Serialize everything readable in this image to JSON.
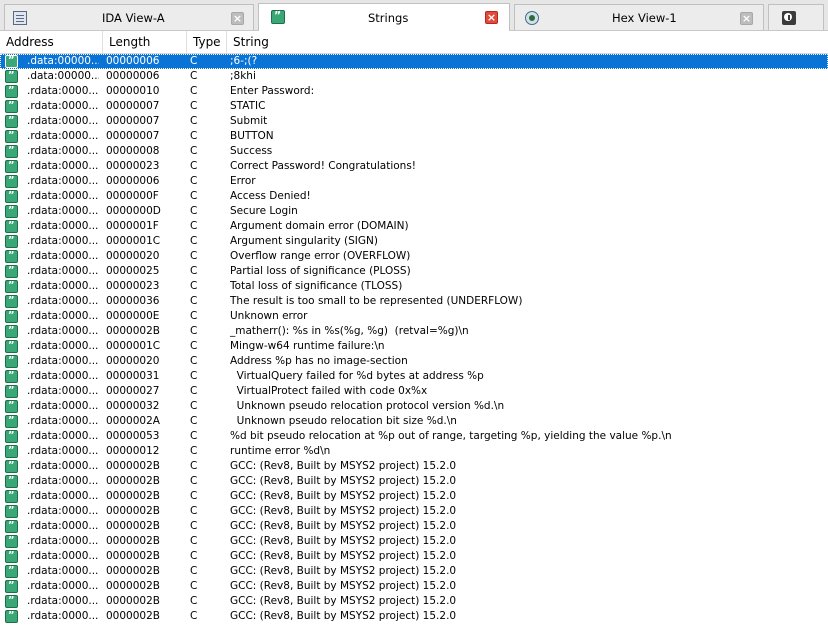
{
  "tabs": [
    {
      "label": "IDA View-A",
      "icon": "ida-view-icon",
      "active": false
    },
    {
      "label": "Strings",
      "icon": "strings-icon",
      "active": true
    },
    {
      "label": "Hex View-1",
      "icon": "hex-view-icon",
      "active": false
    },
    {
      "label": "",
      "icon": "info-icon",
      "active": false
    }
  ],
  "columns": [
    "Address",
    "Length",
    "Type",
    "String"
  ],
  "rows": [
    {
      "address": ".data:00000...",
      "length": "00000006",
      "type": "C",
      "string": ";6-;(?"
    },
    {
      "address": ".data:00000...",
      "length": "00000006",
      "type": "C",
      "string": ";8khi"
    },
    {
      "address": ".rdata:0000...",
      "length": "00000010",
      "type": "C",
      "string": "Enter Password:"
    },
    {
      "address": ".rdata:0000...",
      "length": "00000007",
      "type": "C",
      "string": "STATIC"
    },
    {
      "address": ".rdata:0000...",
      "length": "00000007",
      "type": "C",
      "string": "Submit"
    },
    {
      "address": ".rdata:0000...",
      "length": "00000007",
      "type": "C",
      "string": "BUTTON"
    },
    {
      "address": ".rdata:0000...",
      "length": "00000008",
      "type": "C",
      "string": "Success"
    },
    {
      "address": ".rdata:0000...",
      "length": "00000023",
      "type": "C",
      "string": "Correct Password! Congratulations!"
    },
    {
      "address": ".rdata:0000...",
      "length": "00000006",
      "type": "C",
      "string": "Error"
    },
    {
      "address": ".rdata:0000...",
      "length": "0000000F",
      "type": "C",
      "string": "Access Denied!"
    },
    {
      "address": ".rdata:0000...",
      "length": "0000000D",
      "type": "C",
      "string": "Secure Login"
    },
    {
      "address": ".rdata:0000...",
      "length": "0000001F",
      "type": "C",
      "string": "Argument domain error (DOMAIN)"
    },
    {
      "address": ".rdata:0000...",
      "length": "0000001C",
      "type": "C",
      "string": "Argument singularity (SIGN)"
    },
    {
      "address": ".rdata:0000...",
      "length": "00000020",
      "type": "C",
      "string": "Overflow range error (OVERFLOW)"
    },
    {
      "address": ".rdata:0000...",
      "length": "00000025",
      "type": "C",
      "string": "Partial loss of significance (PLOSS)"
    },
    {
      "address": ".rdata:0000...",
      "length": "00000023",
      "type": "C",
      "string": "Total loss of significance (TLOSS)"
    },
    {
      "address": ".rdata:0000...",
      "length": "00000036",
      "type": "C",
      "string": "The result is too small to be represented (UNDERFLOW)"
    },
    {
      "address": ".rdata:0000...",
      "length": "0000000E",
      "type": "C",
      "string": "Unknown error"
    },
    {
      "address": ".rdata:0000...",
      "length": "0000002B",
      "type": "C",
      "string": "_matherr(): %s in %s(%g, %g)  (retval=%g)\\n"
    },
    {
      "address": ".rdata:0000...",
      "length": "0000001C",
      "type": "C",
      "string": "Mingw-w64 runtime failure:\\n"
    },
    {
      "address": ".rdata:0000...",
      "length": "00000020",
      "type": "C",
      "string": "Address %p has no image-section"
    },
    {
      "address": ".rdata:0000...",
      "length": "00000031",
      "type": "C",
      "string": "  VirtualQuery failed for %d bytes at address %p"
    },
    {
      "address": ".rdata:0000...",
      "length": "00000027",
      "type": "C",
      "string": "  VirtualProtect failed with code 0x%x"
    },
    {
      "address": ".rdata:0000...",
      "length": "00000032",
      "type": "C",
      "string": "  Unknown pseudo relocation protocol version %d.\\n"
    },
    {
      "address": ".rdata:0000...",
      "length": "0000002A",
      "type": "C",
      "string": "  Unknown pseudo relocation bit size %d.\\n"
    },
    {
      "address": ".rdata:0000...",
      "length": "00000053",
      "type": "C",
      "string": "%d bit pseudo relocation at %p out of range, targeting %p, yielding the value %p.\\n"
    },
    {
      "address": ".rdata:0000...",
      "length": "00000012",
      "type": "C",
      "string": "runtime error %d\\n"
    },
    {
      "address": ".rdata:0000...",
      "length": "0000002B",
      "type": "C",
      "string": "GCC: (Rev8, Built by MSYS2 project) 15.2.0"
    },
    {
      "address": ".rdata:0000...",
      "length": "0000002B",
      "type": "C",
      "string": "GCC: (Rev8, Built by MSYS2 project) 15.2.0"
    },
    {
      "address": ".rdata:0000...",
      "length": "0000002B",
      "type": "C",
      "string": "GCC: (Rev8, Built by MSYS2 project) 15.2.0"
    },
    {
      "address": ".rdata:0000...",
      "length": "0000002B",
      "type": "C",
      "string": "GCC: (Rev8, Built by MSYS2 project) 15.2.0"
    },
    {
      "address": ".rdata:0000...",
      "length": "0000002B",
      "type": "C",
      "string": "GCC: (Rev8, Built by MSYS2 project) 15.2.0"
    },
    {
      "address": ".rdata:0000...",
      "length": "0000002B",
      "type": "C",
      "string": "GCC: (Rev8, Built by MSYS2 project) 15.2.0"
    },
    {
      "address": ".rdata:0000...",
      "length": "0000002B",
      "type": "C",
      "string": "GCC: (Rev8, Built by MSYS2 project) 15.2.0"
    },
    {
      "address": ".rdata:0000...",
      "length": "0000002B",
      "type": "C",
      "string": "GCC: (Rev8, Built by MSYS2 project) 15.2.0"
    },
    {
      "address": ".rdata:0000...",
      "length": "0000002B",
      "type": "C",
      "string": "GCC: (Rev8, Built by MSYS2 project) 15.2.0"
    },
    {
      "address": ".rdata:0000...",
      "length": "0000002B",
      "type": "C",
      "string": "GCC: (Rev8, Built by MSYS2 project) 15.2.0"
    },
    {
      "address": ".rdata:0000...",
      "length": "0000002B",
      "type": "C",
      "string": "GCC: (Rev8, Built by MSYS2 project) 15.2.0"
    }
  ],
  "selected_row": 0,
  "colors": {
    "selection": "#0a74d6",
    "string_icon": "#3aa876",
    "close_active": "#e24a3b"
  }
}
